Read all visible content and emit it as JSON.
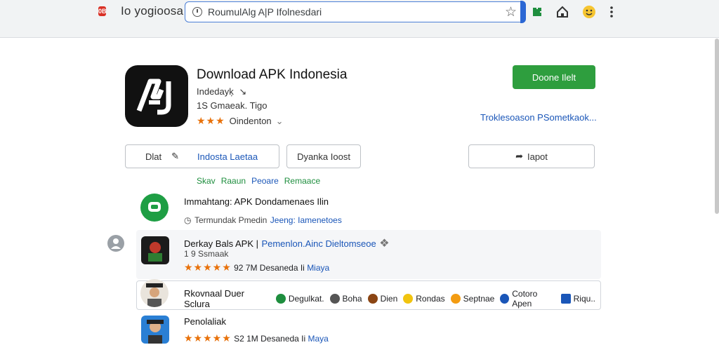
{
  "toolbar": {
    "brand_badge": "0B",
    "brand_name": "Io yogioosa",
    "url": "RoumulAlg A|P Ifolnesdari",
    "icons": [
      "extension-icon",
      "home-icon",
      "emoji-icon",
      "menu-dots-icon"
    ]
  },
  "app": {
    "title": "Download APK Indonesia",
    "developer": "Indedayķ",
    "meta": "1S Gmaeak. Tigo",
    "rating_text": "Oindenton",
    "stars": "★★★",
    "install_label": "Doone Ilelt",
    "info_link": "Troklesoason PSometkaok..."
  },
  "tabs": {
    "first_label": "Dlat",
    "second_label": "Indosta Laetaa",
    "third_label": "Dyanka Ioost",
    "share_label": "Iapot"
  },
  "green_row": [
    "Skav",
    "Raaun",
    "Peoare",
    "Remaace"
  ],
  "items": [
    {
      "title": "Immahtang: APK Dondamenaes Ilin",
      "sub_prefix": "Termundak Pmedin",
      "sub_link": "Jeeng: Iamenetoes"
    },
    {
      "title": "Derkay Bals APK |",
      "title_link": "Pemenlon.Ainc Dieltomseoe",
      "sub": "1 9 Ssmaak",
      "stars": "★★★★★",
      "rating_prefix": "92 7M Desaneda Ii",
      "rating_link": "Miaya"
    },
    {
      "title": "Rkovnaal Duer Sclura",
      "chips": [
        "Degulkat.",
        "Boha",
        "Dien",
        "Rondas",
        "Septnae",
        "Cotoro Apen",
        "Riqu.."
      ]
    },
    {
      "title": "Penolaliak",
      "stars": "★★★★★",
      "rating_prefix": "S2 1M Desaneda Ii",
      "rating_link": "Maya"
    }
  ]
}
